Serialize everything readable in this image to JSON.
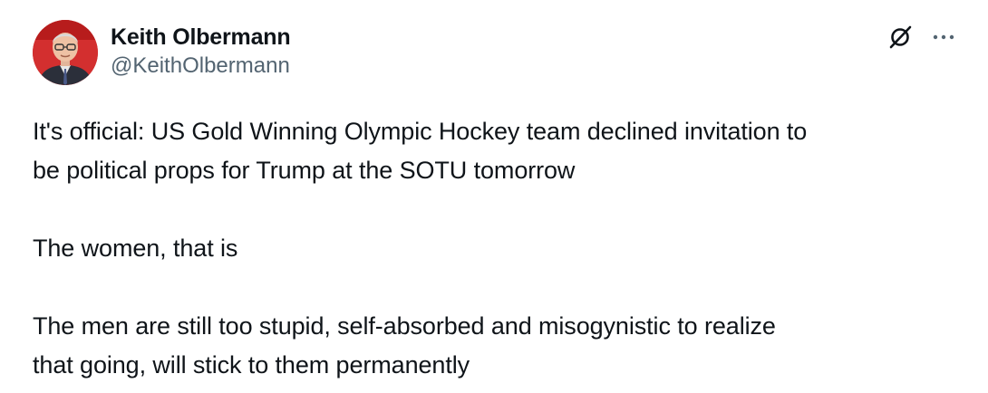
{
  "tweet": {
    "author": {
      "display_name": "Keith Olbermann",
      "handle": "@KeithOlbermann",
      "avatar_icon": "avatar-photo"
    },
    "actions": {
      "grok_icon": "grok-icon",
      "more_icon": "more-options-icon"
    },
    "text": {
      "p1": "It's official: US Gold Winning Olympic Hockey team declined invitation to\nbe political props for Trump at the SOTU tomorrow",
      "p2": "The women, that is",
      "p3": "The men are still too stupid, self-absorbed and misogynistic to realize\nthat going, will stick to them permanently"
    },
    "colors": {
      "text": "#0f1419",
      "secondary": "#536471",
      "avatar_bg": "#c62828"
    }
  }
}
